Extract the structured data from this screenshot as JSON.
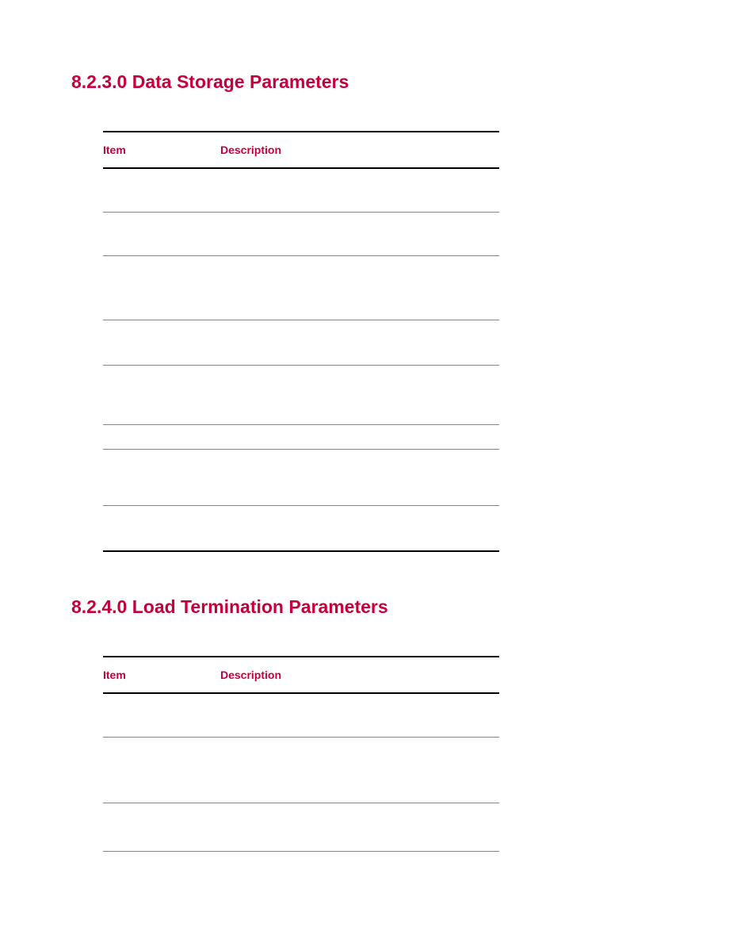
{
  "sections": [
    {
      "heading": "8.2.3.0 Data Storage Parameters",
      "headers": {
        "item": "Item",
        "description": "Description"
      },
      "rows": [
        {
          "item": "",
          "description": ""
        },
        {
          "item": "",
          "description": ""
        },
        {
          "item": "",
          "description": ""
        },
        {
          "item": "",
          "description": ""
        },
        {
          "item": "",
          "description": ""
        },
        {
          "item": "",
          "description": ""
        },
        {
          "item": "",
          "description": ""
        },
        {
          "item": "",
          "description": ""
        }
      ]
    },
    {
      "heading": "8.2.4.0 Load Termination Parameters",
      "headers": {
        "item": "Item",
        "description": "Description"
      },
      "rows": [
        {
          "item": "",
          "description": ""
        },
        {
          "item": "",
          "description": ""
        },
        {
          "item": "",
          "description": ""
        }
      ]
    }
  ]
}
